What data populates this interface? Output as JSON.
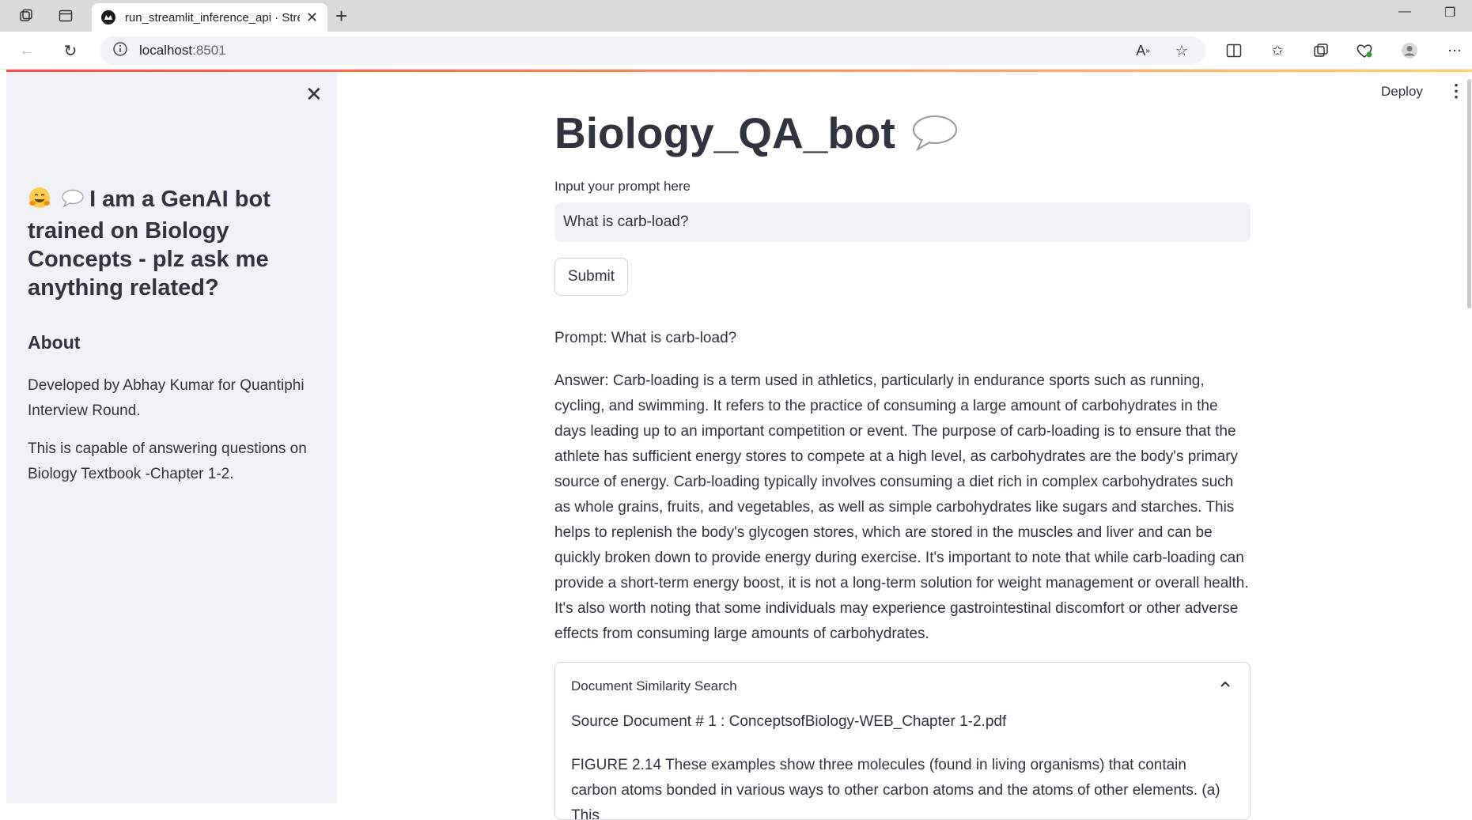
{
  "browser": {
    "tab_title": "run_streamlit_inference_api · Streamlit",
    "url_host": "localhost",
    "url_port": ":8501"
  },
  "sidebar": {
    "heading": "I am a GenAI bot trained on Biology Concepts - plz ask me anything related?",
    "about_title": "About",
    "about_p1": "Developed by Abhay Kumar for Quantiphi Interview Round.",
    "about_p2": "This is capable of answering questions on Biology Textbook -Chapter 1-2."
  },
  "header": {
    "deploy_label": "Deploy"
  },
  "main": {
    "title": "Biology_QA_bot",
    "input_label": "Input your prompt here",
    "input_value": "What is carb-load?",
    "submit_label": "Submit",
    "prompt_text": "Prompt: What is carb-load?",
    "answer_text": "Answer: Carb-loading is a term used in athletics, particularly in endurance sports such as running, cycling, and swimming. It refers to the practice of consuming a large amount of carbohydrates in the days leading up to an important competition or event. The purpose of carb-loading is to ensure that the athlete has sufficient energy stores to compete at a high level, as carbohydrates are the body's primary source of energy. Carb-loading typically involves consuming a diet rich in complex carbohydrates such as whole grains, fruits, and vegetables, as well as simple carbohydrates like sugars and starches. This helps to replenish the body's glycogen stores, which are stored in the muscles and liver and can be quickly broken down to provide energy during exercise. It's important to note that while carb-loading can provide a short-term energy boost, it is not a long-term solution for weight management or overall health. It's also worth noting that some individuals may experience gastrointestinal discomfort or other adverse effects from consuming large amounts of carbohydrates.",
    "expander": {
      "header": "Document Similarity Search",
      "source": "Source Document # 1 : ConceptsofBiology-WEB_Chapter 1-2.pdf",
      "body": "FIGURE 2.14 These examples show three molecules (found in living organisms) that contain carbon atoms bonded in various ways to other carbon atoms and the atoms of other elements. (a) This"
    }
  },
  "icons": {
    "sidebar_emoji_1": "hugging-face-emoji",
    "sidebar_emoji_2": "speech-balloon-emoji",
    "title_icon": "speech-balloon-icon"
  },
  "colors": {
    "text": "#31333f",
    "sidebar_bg": "#f0f2f6",
    "accent": "#ff4b4b"
  }
}
